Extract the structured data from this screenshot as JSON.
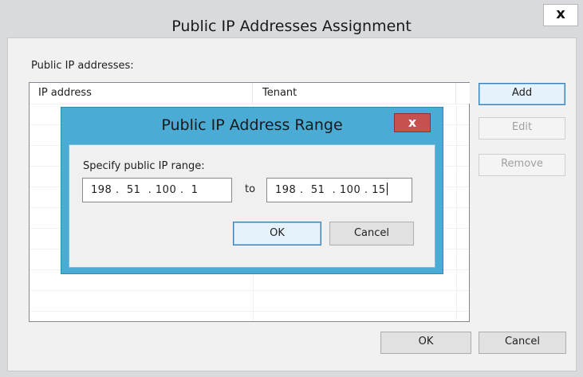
{
  "outer_dialog": {
    "title": "Public IP Addresses Assignment",
    "close_glyph": "x",
    "list_label": "Public IP addresses:",
    "columns": [
      "IP address",
      "Tenant"
    ],
    "buttons": {
      "add": "Add",
      "edit": "Edit",
      "remove": "Remove",
      "ok": "OK",
      "cancel": "Cancel"
    }
  },
  "inner_dialog": {
    "title": "Public IP Address Range",
    "close_glyph": "x",
    "range_label": "Specify public IP range:",
    "from_value": "198 .  51  . 100 .  1",
    "to_label": "to",
    "to_value": "198 .  51  . 100 . 15",
    "buttons": {
      "ok": "OK",
      "cancel": "Cancel"
    },
    "accent_color": "#4aabd4",
    "close_color": "#c75050"
  }
}
